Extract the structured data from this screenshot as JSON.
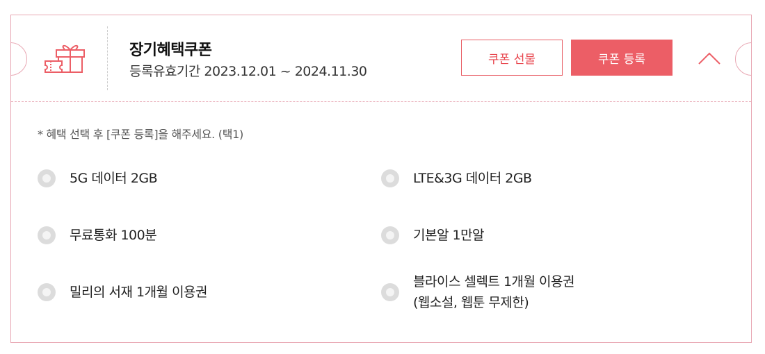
{
  "coupon": {
    "title": "장기혜택쿠폰",
    "period": "등록유효기간 2023.12.01 ~ 2024.11.30",
    "gift_button": "쿠폰 선물",
    "register_button": "쿠폰 등록",
    "accent_color": "#ec5e66",
    "border_color": "#e8a7b3"
  },
  "benefits": {
    "note": "*  혜택 선택 후 [쿠폰 등록]을 해주세요. (택1)",
    "options": [
      {
        "label": "5G 데이터 2GB"
      },
      {
        "label": "LTE&3G 데이터 2GB"
      },
      {
        "label": "무료통화 100분"
      },
      {
        "label": "기본알 1만알"
      },
      {
        "label": "밀리의 서재 1개월 이용권"
      },
      {
        "label_line1": "블라이스 셀렉트 1개월 이용권",
        "label_line2": "(웹소설, 웹툰 무제한)"
      }
    ]
  }
}
